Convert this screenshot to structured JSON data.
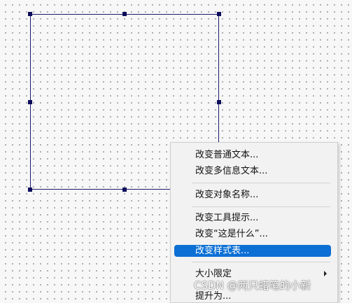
{
  "context_menu": {
    "items": [
      {
        "label": "改变普通文本..."
      },
      {
        "label": "改变多信息文本..."
      },
      {
        "label": "改变对象名称..."
      },
      {
        "label": "改变工具提示..."
      },
      {
        "label": "改变“这是什么”..."
      },
      {
        "label": "改变样式表..."
      },
      {
        "label": "大小限定"
      },
      {
        "label": "提升为..."
      }
    ],
    "selected_color": "#0b6fd4"
  },
  "watermark": {
    "text": "CSDN @两只蜡笔的小新"
  }
}
